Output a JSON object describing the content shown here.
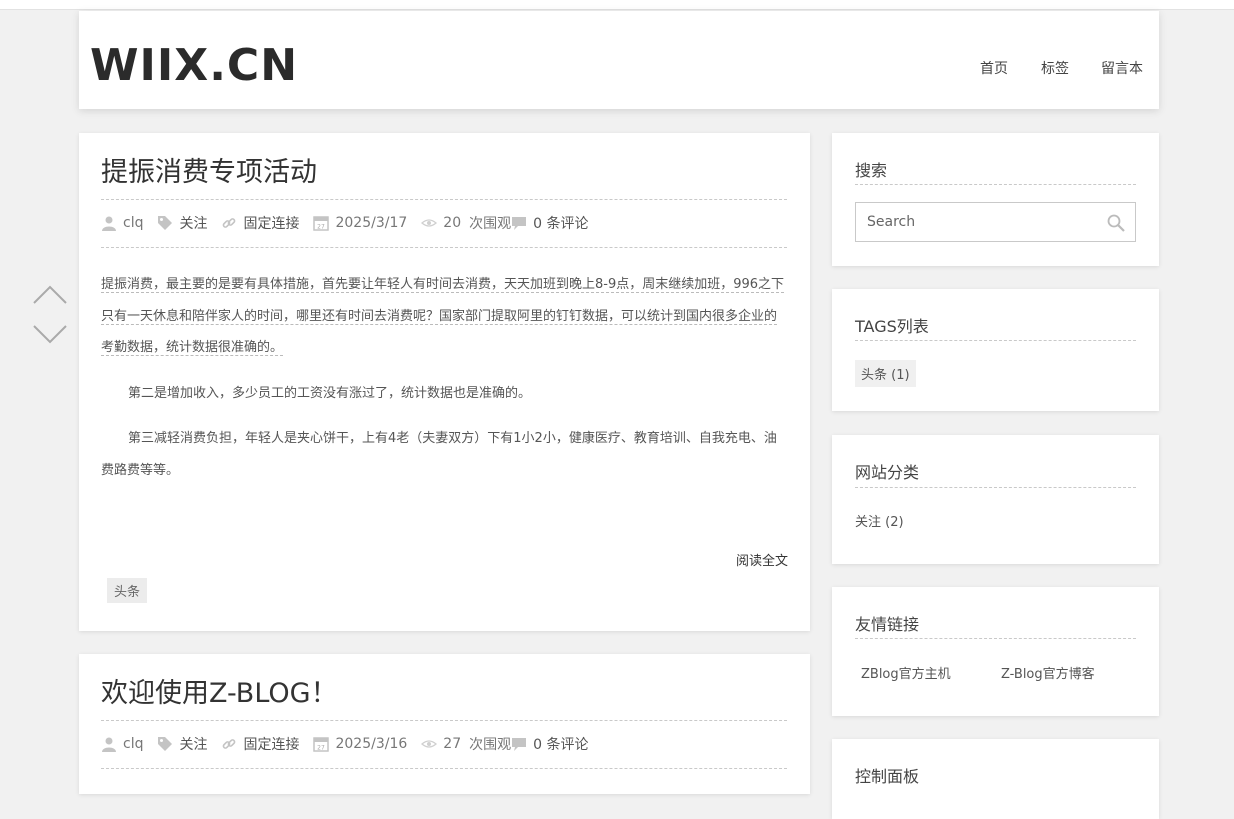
{
  "site": {
    "logo": "WIIX.CN",
    "nav": [
      "首页",
      "标签",
      "留言本"
    ]
  },
  "posts": [
    {
      "title": "提振消费专项活动",
      "meta": {
        "author": "clq",
        "category": "关注",
        "permalink": "固定连接",
        "date": "2025/3/17",
        "views": "20",
        "views_label": "次围观",
        "comments": "0 条评论"
      },
      "paragraphs": [
        "提振消费，最主要的是要有具体措施，首先要让年轻人有时间去消费，天天加班到晚上8-9点，周末继续加班，996之下只有一天休息和陪伴家人的时间，哪里还有时间去消费呢？国家部门提取阿里的钉钉数据，可以统计到国内很多企业的考勤数据，统计数据很准确的。",
        "第二是增加收入，多少员工的工资没有涨过了，统计数据也是准确的。",
        "第三减轻消费负担，年轻人是夹心饼干，上有4老（夫妻双方）下有1小2小，健康医疗、教育培训、自我充电、油费路费等等。"
      ],
      "read_more": "阅读全文",
      "tag": "头条"
    },
    {
      "title": "欢迎使用Z-BLOG！",
      "meta": {
        "author": "clq",
        "category": "关注",
        "permalink": "固定连接",
        "date": "2025/3/16",
        "views": "27",
        "views_label": "次围观",
        "comments": "0 条评论"
      }
    }
  ],
  "sidebar": {
    "search": {
      "title": "搜索",
      "placeholder": "Search"
    },
    "tags": {
      "title": "TAGS列表",
      "items": [
        "头条 (1)"
      ]
    },
    "categories": {
      "title": "网站分类",
      "items": [
        "关注 (2)"
      ]
    },
    "links": {
      "title": "友情链接",
      "items": [
        "ZBlog官方主机",
        "Z-Blog官方博客"
      ]
    },
    "control": {
      "title": "控制面板"
    }
  },
  "icons": {
    "author": "user-icon",
    "category": "tag-icon",
    "permalink": "link-icon",
    "date": "calendar-icon",
    "views": "eye-icon",
    "comments": "comment-icon",
    "search": "search-icon",
    "prev": "chevron-up-icon",
    "next": "chevron-down-icon"
  }
}
